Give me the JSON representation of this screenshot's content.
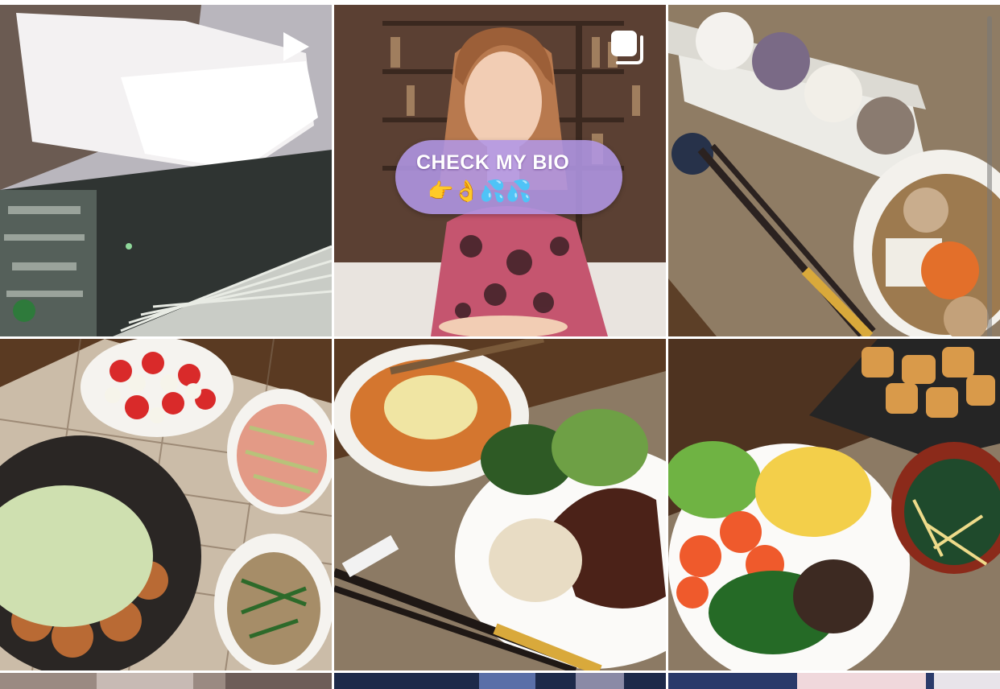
{
  "grid": {
    "tiles": [
      {
        "id": "post-1",
        "type": "video",
        "badge_icon": "play-icon"
      },
      {
        "id": "post-2",
        "type": "carousel",
        "badge_icon": "carousel-icon",
        "caption_text": "CHECK MY BIO",
        "emoji_row": "👉👌💦💦"
      },
      {
        "id": "post-3",
        "type": "photo"
      },
      {
        "id": "post-4",
        "type": "photo"
      },
      {
        "id": "post-5",
        "type": "photo"
      },
      {
        "id": "post-6",
        "type": "photo"
      },
      {
        "id": "post-7",
        "type": "photo"
      },
      {
        "id": "post-8",
        "type": "photo"
      },
      {
        "id": "post-9",
        "type": "photo"
      }
    ]
  },
  "colors": {
    "table_brown": "#5a3a22",
    "placemat": "#8c7a64",
    "bubble_purple": "#b096e6",
    "icon_white": "#ffffff"
  }
}
